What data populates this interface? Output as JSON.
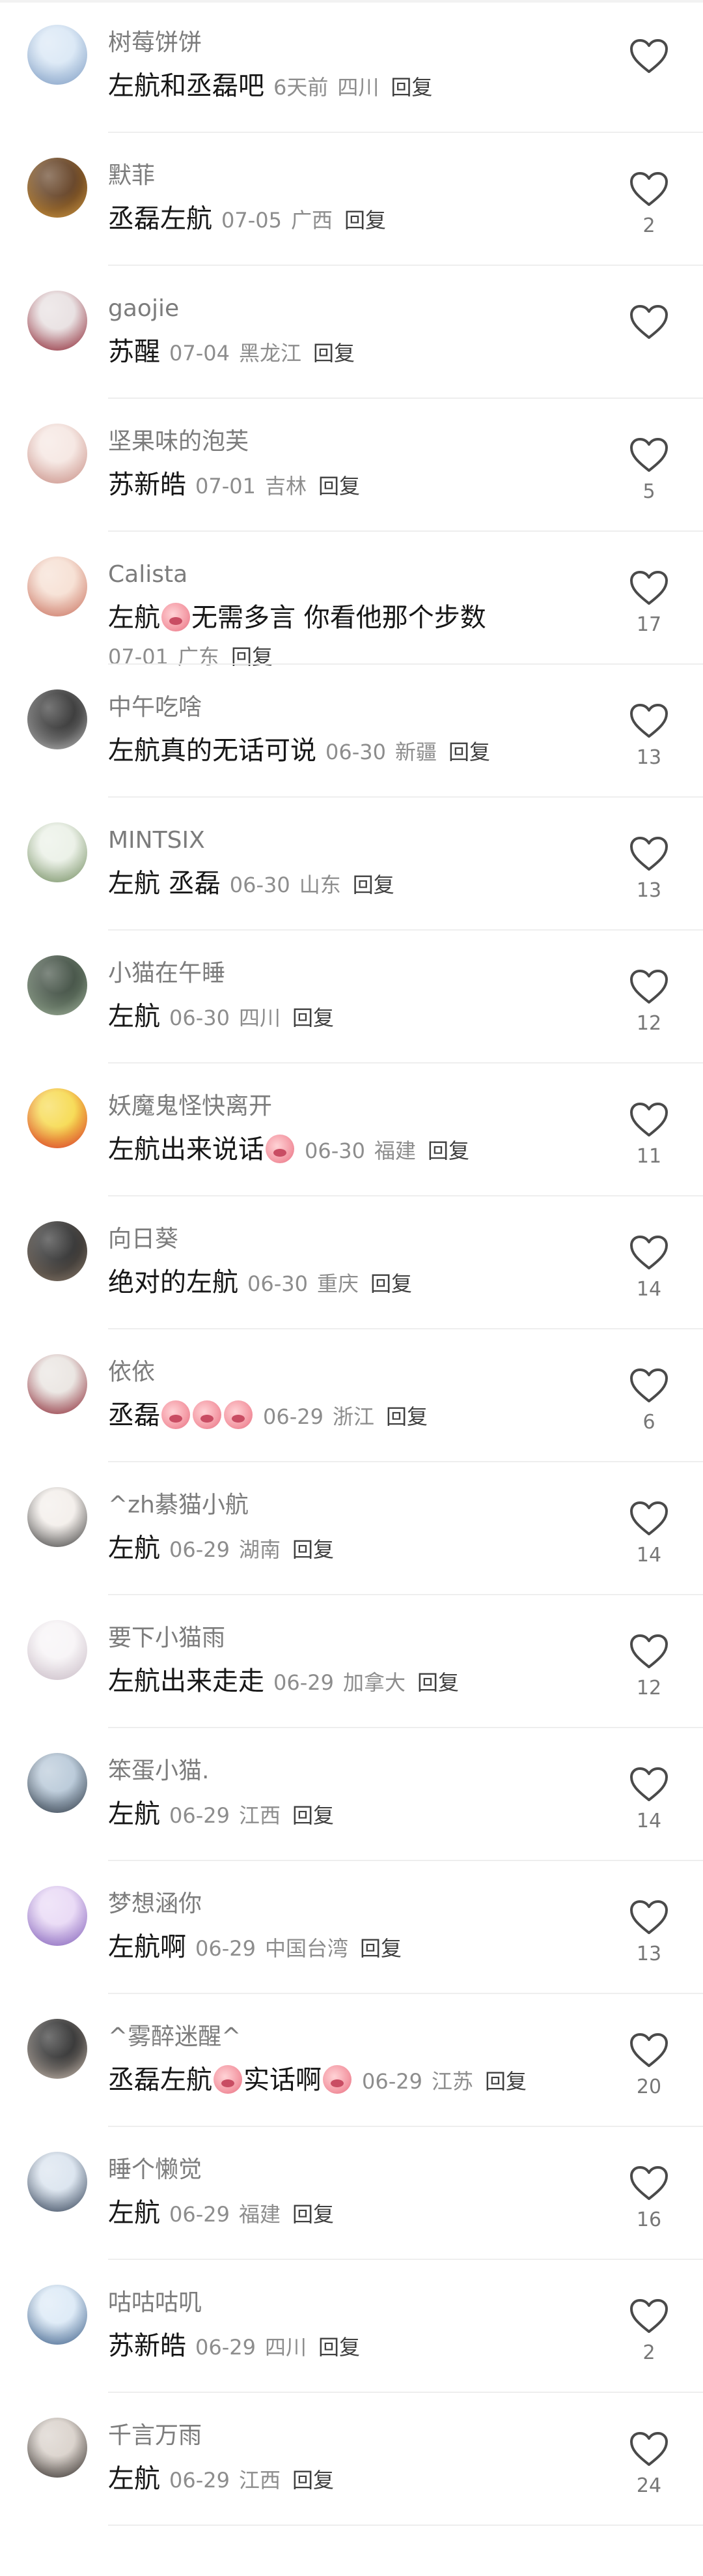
{
  "comments": [
    {
      "username": "树莓饼饼",
      "text": "左航和丞磊吧",
      "time": "6天前",
      "location": "四川",
      "reply": "回复",
      "likes": "",
      "avatar_colors": [
        "#d9e7f5",
        "#7d9bc2"
      ]
    },
    {
      "username": "默菲",
      "text": "丞磊左航",
      "time": "07-05",
      "location": "广西",
      "reply": "回复",
      "likes": "2",
      "avatar_colors": [
        "#5e3a1c",
        "#d29a42"
      ]
    },
    {
      "username": "gaojie",
      "text": "苏醒",
      "time": "07-04",
      "location": "黑龙江",
      "reply": "回复",
      "likes": "",
      "avatar_colors": [
        "#e7dfe0",
        "#8b1f2d"
      ]
    },
    {
      "username": "坚果味的泡芙",
      "text": "苏新皓",
      "time": "07-01",
      "location": "吉林",
      "reply": "回复",
      "likes": "5",
      "avatar_colors": [
        "#f5e6e1",
        "#c78c83"
      ]
    },
    {
      "username": "Calista",
      "text": "左航",
      "text2": "无需多言 你看他那个步数",
      "time": "07-01",
      "location": "广东",
      "reply": "回复",
      "likes": "17",
      "avatar_colors": [
        "#f6dfd2",
        "#c86f5d"
      ]
    },
    {
      "username": "中午吃啥",
      "text": "左航真的无话可说",
      "time": "06-30",
      "location": "新疆",
      "reply": "回复",
      "likes": "13",
      "avatar_colors": [
        "#2f2f2f",
        "#bfbfbf"
      ]
    },
    {
      "username": "MINTSIX",
      "text": "左航 丞磊",
      "time": "06-30",
      "location": "山东",
      "reply": "回复",
      "likes": "13",
      "avatar_colors": [
        "#eaf0e6",
        "#6f8a5c"
      ]
    },
    {
      "username": "小猫在午睡",
      "text": "左航",
      "time": "06-30",
      "location": "四川",
      "reply": "回复",
      "likes": "12",
      "avatar_colors": [
        "#3b4a3d",
        "#a6b8a1"
      ]
    },
    {
      "username": "妖魔鬼怪快离开",
      "text": "左航出来说话",
      "time": "06-30",
      "location": "福建",
      "reply": "回复",
      "likes": "11",
      "avatar_colors": [
        "#f6d94b",
        "#d8302b"
      ]
    },
    {
      "username": "向日葵",
      "text": "绝对的左航",
      "time": "06-30",
      "location": "重庆",
      "reply": "回复",
      "likes": "14",
      "avatar_colors": [
        "#2b2b2b",
        "#8c7b6b"
      ]
    },
    {
      "username": "依依",
      "text": "丞磊",
      "time": "06-29",
      "location": "浙江",
      "reply": "回复",
      "likes": "6",
      "avatar_colors": [
        "#e9e4e0",
        "#8a2330"
      ]
    },
    {
      "username": "^zh綦猫小航",
      "text": "左航",
      "time": "06-29",
      "location": "湖南",
      "reply": "回复",
      "likes": "14",
      "avatar_colors": [
        "#f3eeea",
        "#3a3a3a"
      ]
    },
    {
      "username": "要下小猫雨",
      "text": "左航出来走走",
      "time": "06-29",
      "location": "加拿大",
      "reply": "回复",
      "likes": "12",
      "avatar_colors": [
        "#f7f4f6",
        "#c7b9c4"
      ]
    },
    {
      "username": "笨蛋小猫.",
      "text": "左航",
      "time": "06-29",
      "location": "江西",
      "reply": "回复",
      "likes": "14",
      "avatar_colors": [
        "#b6c7d7",
        "#2d3743"
      ]
    },
    {
      "username": "梦想涵你",
      "text": "左航啊",
      "time": "06-29",
      "location": "中国台湾",
      "reply": "回复",
      "likes": "13",
      "avatar_colors": [
        "#e8d8f5",
        "#7f5db8"
      ]
    },
    {
      "username": "^雾醉迷醒^",
      "text": "丞磊左航",
      "text2": "实话啊",
      "time": "06-29",
      "location": "江苏",
      "reply": "回复",
      "likes": "20",
      "avatar_colors": [
        "#2b2b2b",
        "#d1c3b7"
      ]
    },
    {
      "username": "睡个懒觉",
      "text": "左航",
      "time": "06-29",
      "location": "福建",
      "reply": "回复",
      "likes": "16",
      "avatar_colors": [
        "#d9e3ee",
        "#2f3d52"
      ]
    },
    {
      "username": "咕咕咕叽",
      "text": "苏新皓",
      "time": "06-29",
      "location": "四川",
      "reply": "回复",
      "likes": "2",
      "avatar_colors": [
        "#dbe9f6",
        "#3a5c86"
      ]
    },
    {
      "username": "千言万雨",
      "text": "左航",
      "time": "06-29",
      "location": "江西",
      "reply": "回复",
      "likes": "24",
      "avatar_colors": [
        "#d8d0c9",
        "#2f2a27"
      ]
    }
  ],
  "icons": {
    "like": "heart-outline-icon",
    "emoji": "pig-face-emoji-icon"
  },
  "colors": {
    "username": "#7c7c7c",
    "text": "#161616",
    "meta": "#8d8d8d",
    "divider": "#eeeeee",
    "heart": "#4a4a4a"
  }
}
